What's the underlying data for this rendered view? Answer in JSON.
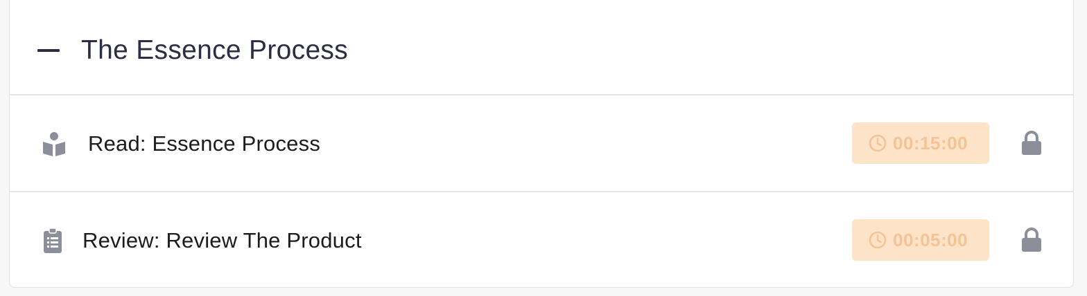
{
  "section": {
    "title": "The Essence Process",
    "expanded": true,
    "toggle_icon": "minus-icon"
  },
  "lessons": [
    {
      "type": "read",
      "icon": "book-reader-icon",
      "label": "Read: Essence Process",
      "duration": "00:15:00",
      "locked": true
    },
    {
      "type": "review",
      "icon": "clipboard-list-icon",
      "label": "Review: Review The Product",
      "duration": "00:05:00",
      "locked": true
    }
  ],
  "colors": {
    "title_text": "#2b2d42",
    "badge_background": "#fde3c8",
    "badge_text": "#f4c396",
    "icon_gray": "#8a8f99",
    "divider": "#e4e4e8"
  }
}
